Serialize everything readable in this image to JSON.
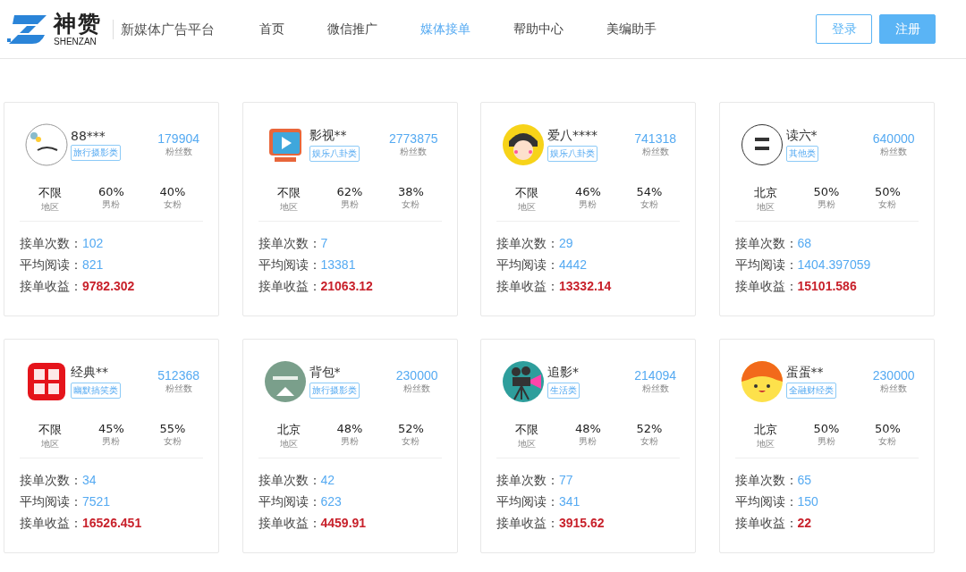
{
  "header": {
    "logo": {
      "name": "神赞",
      "latin": "SHENZAN"
    },
    "slogan": "新媒体广告平台",
    "nav": [
      {
        "label": "首页",
        "selected": false
      },
      {
        "label": "微信推广",
        "selected": false
      },
      {
        "label": "媒体接单",
        "selected": true
      },
      {
        "label": "帮助中心",
        "selected": false
      },
      {
        "label": "美编助手",
        "selected": false
      }
    ],
    "login": "登录",
    "register": "注册"
  },
  "cards": [
    {
      "name": "88***",
      "category": "旅行摄影类",
      "fans": "179904",
      "fans_label": "粉丝数",
      "stats": [
        {
          "value": "不限",
          "label": "地区"
        },
        {
          "value": "60%",
          "label": "男粉"
        },
        {
          "value": "40%",
          "label": "女粉"
        }
      ],
      "orders_label": "接单次数：",
      "orders": "102",
      "reads_label": "平均阅读：",
      "reads": "821",
      "income_label": "接单收益：",
      "income": "9782.302"
    },
    {
      "name": "影视**",
      "category": "娱乐八卦类",
      "fans": "2773875",
      "fans_label": "粉丝数",
      "stats": [
        {
          "value": "不限",
          "label": "地区"
        },
        {
          "value": "62%",
          "label": "男粉"
        },
        {
          "value": "38%",
          "label": "女粉"
        }
      ],
      "orders_label": "接单次数：",
      "orders": "7",
      "reads_label": "平均阅读：",
      "reads": "13381",
      "income_label": "接单收益：",
      "income": "21063.12"
    },
    {
      "name": "爱八****",
      "category": "娱乐八卦类",
      "fans": "741318",
      "fans_label": "粉丝数",
      "stats": [
        {
          "value": "不限",
          "label": "地区"
        },
        {
          "value": "46%",
          "label": "男粉"
        },
        {
          "value": "54%",
          "label": "女粉"
        }
      ],
      "orders_label": "接单次数：",
      "orders": "29",
      "reads_label": "平均阅读：",
      "reads": "4442",
      "income_label": "接单收益：",
      "income": "13332.14"
    },
    {
      "name": "读六*",
      "category": "其他类",
      "fans": "640000",
      "fans_label": "粉丝数",
      "stats": [
        {
          "value": "北京",
          "label": "地区"
        },
        {
          "value": "50%",
          "label": "男粉"
        },
        {
          "value": "50%",
          "label": "女粉"
        }
      ],
      "orders_label": "接单次数：",
      "orders": "68",
      "reads_label": "平均阅读：",
      "reads": "1404.397059",
      "income_label": "接单收益：",
      "income": "15101.586"
    },
    {
      "name": "经典**",
      "category": "幽默搞笑类",
      "fans": "512368",
      "fans_label": "粉丝数",
      "stats": [
        {
          "value": "不限",
          "label": "地区"
        },
        {
          "value": "45%",
          "label": "男粉"
        },
        {
          "value": "55%",
          "label": "女粉"
        }
      ],
      "orders_label": "接单次数：",
      "orders": "34",
      "reads_label": "平均阅读：",
      "reads": "7521",
      "income_label": "接单收益：",
      "income": "16526.451"
    },
    {
      "name": "背包*",
      "category": "旅行摄影类",
      "fans": "230000",
      "fans_label": "粉丝数",
      "stats": [
        {
          "value": "北京",
          "label": "地区"
        },
        {
          "value": "48%",
          "label": "男粉"
        },
        {
          "value": "52%",
          "label": "女粉"
        }
      ],
      "orders_label": "接单次数：",
      "orders": "42",
      "reads_label": "平均阅读：",
      "reads": "623",
      "income_label": "接单收益：",
      "income": "4459.91"
    },
    {
      "name": "追影*",
      "category": "生活类",
      "fans": "214094",
      "fans_label": "粉丝数",
      "stats": [
        {
          "value": "不限",
          "label": "地区"
        },
        {
          "value": "48%",
          "label": "男粉"
        },
        {
          "value": "52%",
          "label": "女粉"
        }
      ],
      "orders_label": "接单次数：",
      "orders": "77",
      "reads_label": "平均阅读：",
      "reads": "341",
      "income_label": "接单收益：",
      "income": "3915.62"
    },
    {
      "name": "蛋蛋**",
      "category": "全融财经类",
      "fans": "230000",
      "fans_label": "粉丝数",
      "stats": [
        {
          "value": "北京",
          "label": "地区"
        },
        {
          "value": "50%",
          "label": "男粉"
        },
        {
          "value": "50%",
          "label": "女粉"
        }
      ],
      "orders_label": "接单次数：",
      "orders": "65",
      "reads_label": "平均阅读：",
      "reads": "150",
      "income_label": "接单收益：",
      "income": "22"
    }
  ]
}
